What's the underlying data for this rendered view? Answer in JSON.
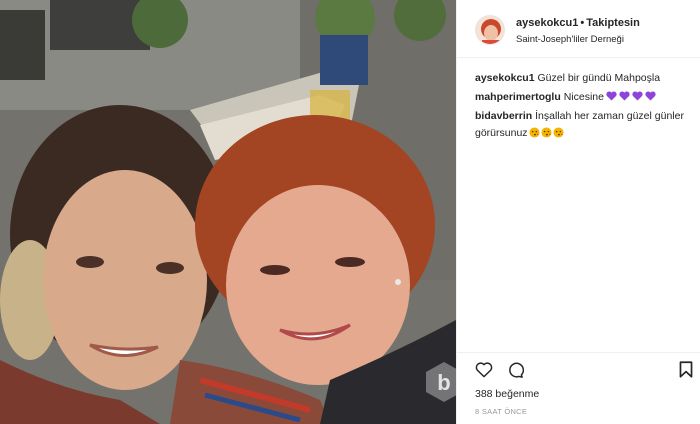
{
  "post": {
    "username": "aysekokcu1",
    "follow_status": "Takiptesin",
    "location": "Saint-Joseph'liler Derneği"
  },
  "comments": [
    {
      "user": "aysekokcu1",
      "text": "Güzel bir gündü Mahpoşla",
      "emojis": []
    },
    {
      "user": "mahperimertoglu",
      "text": "Nicesine",
      "emojis": [
        "purple-heart",
        "purple-heart",
        "purple-heart",
        "purple-heart"
      ]
    },
    {
      "user": "bidavberrin",
      "text": "İnşallah her zaman güzel günler görürsunuz",
      "emojis": [
        "kissing-face",
        "kissing-face",
        "kissing-face"
      ]
    }
  ],
  "actions": {
    "like_icon": "heart-outline-icon",
    "comment_icon": "speech-bubble-icon",
    "save_icon": "bookmark-icon"
  },
  "likes": "388 beğenme",
  "timestamp": "8 SAAT ÖNCE",
  "colors": {
    "heart_emoji": "#8e44d9",
    "face_emoji": "#f4b400",
    "muted_text": "#999999",
    "divider": "#efefef"
  }
}
